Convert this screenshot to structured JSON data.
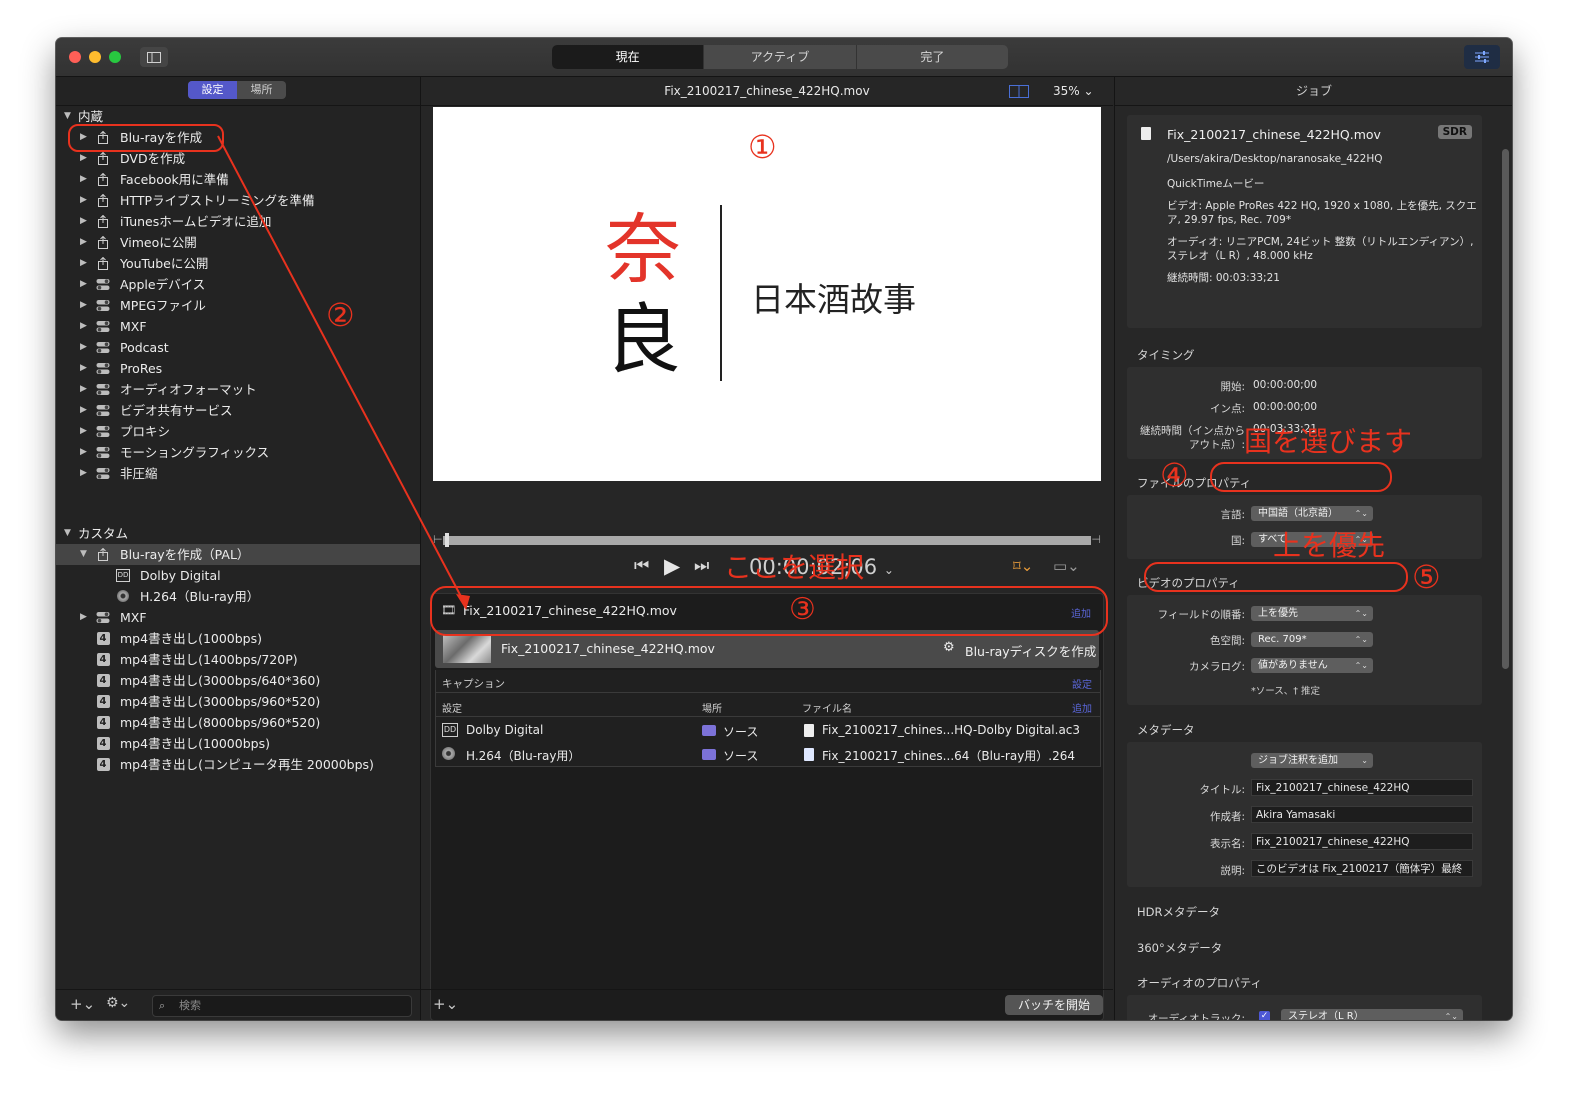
{
  "titlebar": {
    "segments": [
      "現在",
      "アクティブ",
      "完了"
    ],
    "active_segment": 0
  },
  "left": {
    "tabs": [
      "設定",
      "場所"
    ],
    "sections": [
      {
        "label": "内蔵"
      },
      {
        "label": "カスタム"
      }
    ],
    "builtin_items": [
      {
        "label": "Blu-rayを作成",
        "icon": "share-icon"
      },
      {
        "label": "DVDを作成",
        "icon": "share-icon"
      },
      {
        "label": "Facebook用に準備",
        "icon": "share-icon"
      },
      {
        "label": "HTTPライブストリーミングを準備",
        "icon": "share-icon"
      },
      {
        "label": "iTunesホームビデオに追加",
        "icon": "share-icon"
      },
      {
        "label": "Vimeoに公開",
        "icon": "share-icon"
      },
      {
        "label": "YouTubeに公開",
        "icon": "share-icon"
      },
      {
        "label": "Appleデバイス",
        "icon": "toggle-icon"
      },
      {
        "label": "MPEGファイル",
        "icon": "toggle-icon"
      },
      {
        "label": "MXF",
        "icon": "toggle-icon"
      },
      {
        "label": "Podcast",
        "icon": "toggle-icon"
      },
      {
        "label": "ProRes",
        "icon": "toggle-icon"
      },
      {
        "label": "オーディオフォーマット",
        "icon": "toggle-icon"
      },
      {
        "label": "ビデオ共有サービス",
        "icon": "toggle-icon"
      },
      {
        "label": "プロキシ",
        "icon": "toggle-icon"
      },
      {
        "label": "モーショングラフィックス",
        "icon": "toggle-icon"
      },
      {
        "label": "非圧縮",
        "icon": "toggle-icon"
      }
    ],
    "custom_items": [
      {
        "label": "Blu-rayを作成（PAL）",
        "icon": "share-icon",
        "expanded": true
      },
      {
        "label": "Dolby Digital",
        "icon": "dolby-icon",
        "child": true
      },
      {
        "label": "H.264（Blu-ray用）",
        "icon": "disc-icon",
        "child": true
      },
      {
        "label": "MXF",
        "icon": "toggle-icon"
      },
      {
        "label": "mp4書き出し(1000bps)",
        "icon": "mp4-icon"
      },
      {
        "label": "mp4書き出し(1400bps/720P)",
        "icon": "mp4-icon"
      },
      {
        "label": "mp4書き出し(3000bps/640*360)",
        "icon": "mp4-icon"
      },
      {
        "label": "mp4書き出し(3000bps/960*520)",
        "icon": "mp4-icon"
      },
      {
        "label": "mp4書き出し(8000bps/960*520)",
        "icon": "mp4-icon"
      },
      {
        "label": "mp4書き出し(10000bps)",
        "icon": "mp4-icon"
      },
      {
        "label": "mp4書き出し(コンピュータ再生 20000bps)",
        "icon": "mp4-icon"
      }
    ],
    "mp4_badge": "4",
    "search_placeholder": "検索"
  },
  "center": {
    "filename": "Fix_2100217_chinese_422HQ.mov",
    "zoom": "35%",
    "preview": {
      "big1": "奈",
      "big2": "良",
      "subtitle": "日本酒故事"
    },
    "timecode": "00:00:02;06",
    "job": {
      "title": "Fix_2100217_chinese_422HQ.mov",
      "add": "追加",
      "output_name": "Fix_2100217_chinese_422HQ.mov",
      "output_setting": "Blu-rayディスクを作成",
      "caption_label": "キャプション",
      "caption_action": "設定",
      "col_setting": "設定",
      "col_location": "場所",
      "col_filename": "ファイル名",
      "col_add": "追加",
      "rows": [
        {
          "setting": "Dolby Digital",
          "location": "ソース",
          "file": "Fix_2100217_chines...HQ-Dolby Digital.ac3"
        },
        {
          "setting": "H.264（Blu-ray用）",
          "location": "ソース",
          "file": "Fix_2100217_chines...64（Blu-ray用）.264"
        }
      ]
    },
    "batch_button": "バッチを開始"
  },
  "right": {
    "header": "ジョブ",
    "file": {
      "name": "Fix_2100217_chinese_422HQ.mov",
      "badge": "SDR",
      "path": "/Users/akira/Desktop/naranosake_422HQ",
      "type": "QuickTimeムービー",
      "video_line1": "ビデオ: Apple ProRes 422 HQ, 1920 x 1080, 上を優先, スクエ",
      "video_line2": "ア, 29.97 fps, Rec. 709*",
      "audio_line1": "オーディオ: リニアPCM, 24ビット 整数（リトルエンディアン）,",
      "audio_line2": "ステレオ（L R）, 48.000 kHz",
      "duration": "継続時間: 00:03:33;21"
    },
    "timing": {
      "title": "タイミング",
      "start_label": "開始:",
      "start": "00:00:00;00",
      "in_label": "イン点:",
      "in": "00:00:00;00",
      "dur_label1": "継続時間（イン点から",
      "dur_label2": "アウト点）:",
      "dur": "00:03:33;21"
    },
    "file_props": {
      "title": "ファイルのプロパティ",
      "lang_label": "言語:",
      "lang": "中国語（北京語）",
      "country_label": "国:",
      "country": "すべて"
    },
    "video_props": {
      "title": "ビデオのプロパティ",
      "field_label": "フィールドの順番:",
      "field": "上を優先",
      "color_label": "色空間:",
      "color": "Rec. 709*",
      "log_label": "カメラログ:",
      "log": "値がありません",
      "note": "*ソース、† 推定"
    },
    "metadata": {
      "title": "メタデータ",
      "add_annotation": "ジョブ注釈を追加",
      "title_label": "タイトル:",
      "title_value": "Fix_2100217_chinese_422HQ",
      "author_label": "作成者:",
      "author": "Akira Yamasaki",
      "display_label": "表示名:",
      "display": "Fix_2100217_chinese_422HQ",
      "desc_label": "説明:",
      "desc": "このビデオは Fix_2100217（簡体字）最終"
    },
    "hdr_title": "HDRメタデータ",
    "v360_title": "360°メタデータ",
    "audio_props": {
      "title": "オーディオのプロパティ",
      "track_label": "オーディオトラック:",
      "track": "ステレオ（L R）"
    }
  },
  "annotations": {
    "n1": "①",
    "n2": "②",
    "n3": "③",
    "n4": "④",
    "n5": "⑤",
    "select_here": "ここを選択",
    "choose_country": "国を選びます",
    "upper_first": "上を優先"
  },
  "colors": {
    "accent": "#5458c9",
    "annotation": "#e8321e",
    "link": "#5a66d8"
  }
}
